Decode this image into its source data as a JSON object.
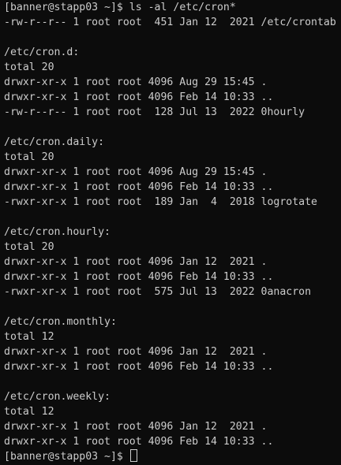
{
  "terminal": {
    "prompt": "[banner@stapp03 ~]$ ",
    "command": "ls -al /etc/cron*",
    "lines": [
      "-rw-r--r-- 1 root root  451 Jan 12  2021 /etc/crontab",
      "",
      "/etc/cron.d:",
      "total 20",
      "drwxr-xr-x 1 root root 4096 Aug 29 15:45 .",
      "drwxr-xr-x 1 root root 4096 Feb 14 10:33 ..",
      "-rw-r--r-- 1 root root  128 Jul 13  2022 0hourly",
      "",
      "/etc/cron.daily:",
      "total 20",
      "drwxr-xr-x 1 root root 4096 Aug 29 15:45 .",
      "drwxr-xr-x 1 root root 4096 Feb 14 10:33 ..",
      "-rwxr-xr-x 1 root root  189 Jan  4  2018 logrotate",
      "",
      "/etc/cron.hourly:",
      "total 20",
      "drwxr-xr-x 1 root root 4096 Jan 12  2021 .",
      "drwxr-xr-x 1 root root 4096 Feb 14 10:33 ..",
      "-rwxr-xr-x 1 root root  575 Jul 13  2022 0anacron",
      "",
      "/etc/cron.monthly:",
      "total 12",
      "drwxr-xr-x 1 root root 4096 Jan 12  2021 .",
      "drwxr-xr-x 1 root root 4096 Feb 14 10:33 ..",
      "",
      "/etc/cron.weekly:",
      "total 12",
      "drwxr-xr-x 1 root root 4096 Jan 12  2021 .",
      "drwxr-xr-x 1 root root 4096 Feb 14 10:33 .."
    ],
    "final_prompt": "[banner@stapp03 ~]$ ",
    "colors": {
      "background": "#0c0c0c",
      "foreground": "#cccccc"
    }
  }
}
